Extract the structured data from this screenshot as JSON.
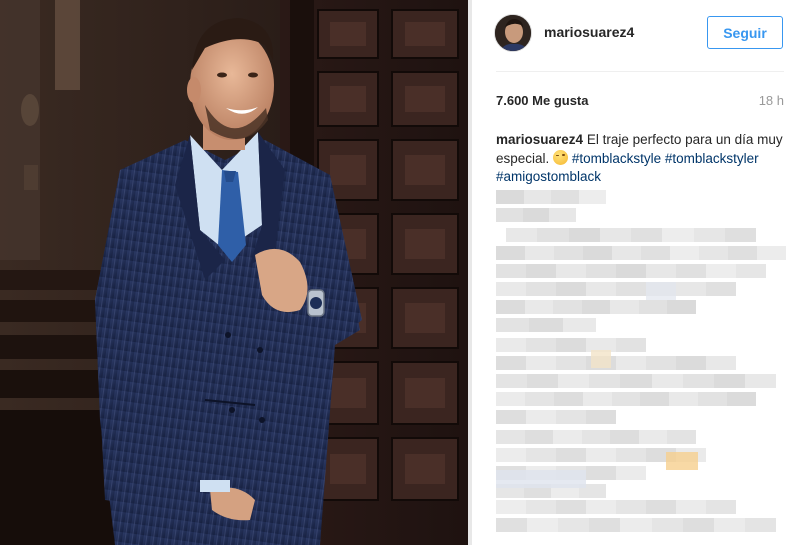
{
  "post": {
    "author": {
      "username": "mariosuarez4"
    },
    "follow_label": "Seguir",
    "likes_label": "7.600 Me gusta",
    "time_label": "18 h",
    "caption": {
      "username": "mariosuarez4",
      "text": "El traje perfecto para un día muy especial.",
      "emoji": "winking-face-emoji",
      "hashtags": [
        "#tomblackstyle",
        "#tomblackstyler",
        "#amigostomblack"
      ]
    },
    "comments_blurred": true
  },
  "colors": {
    "follow_blue": "#3897f0",
    "hashtag_blue": "#003569",
    "muted_gray": "#999999",
    "text": "#262626"
  }
}
